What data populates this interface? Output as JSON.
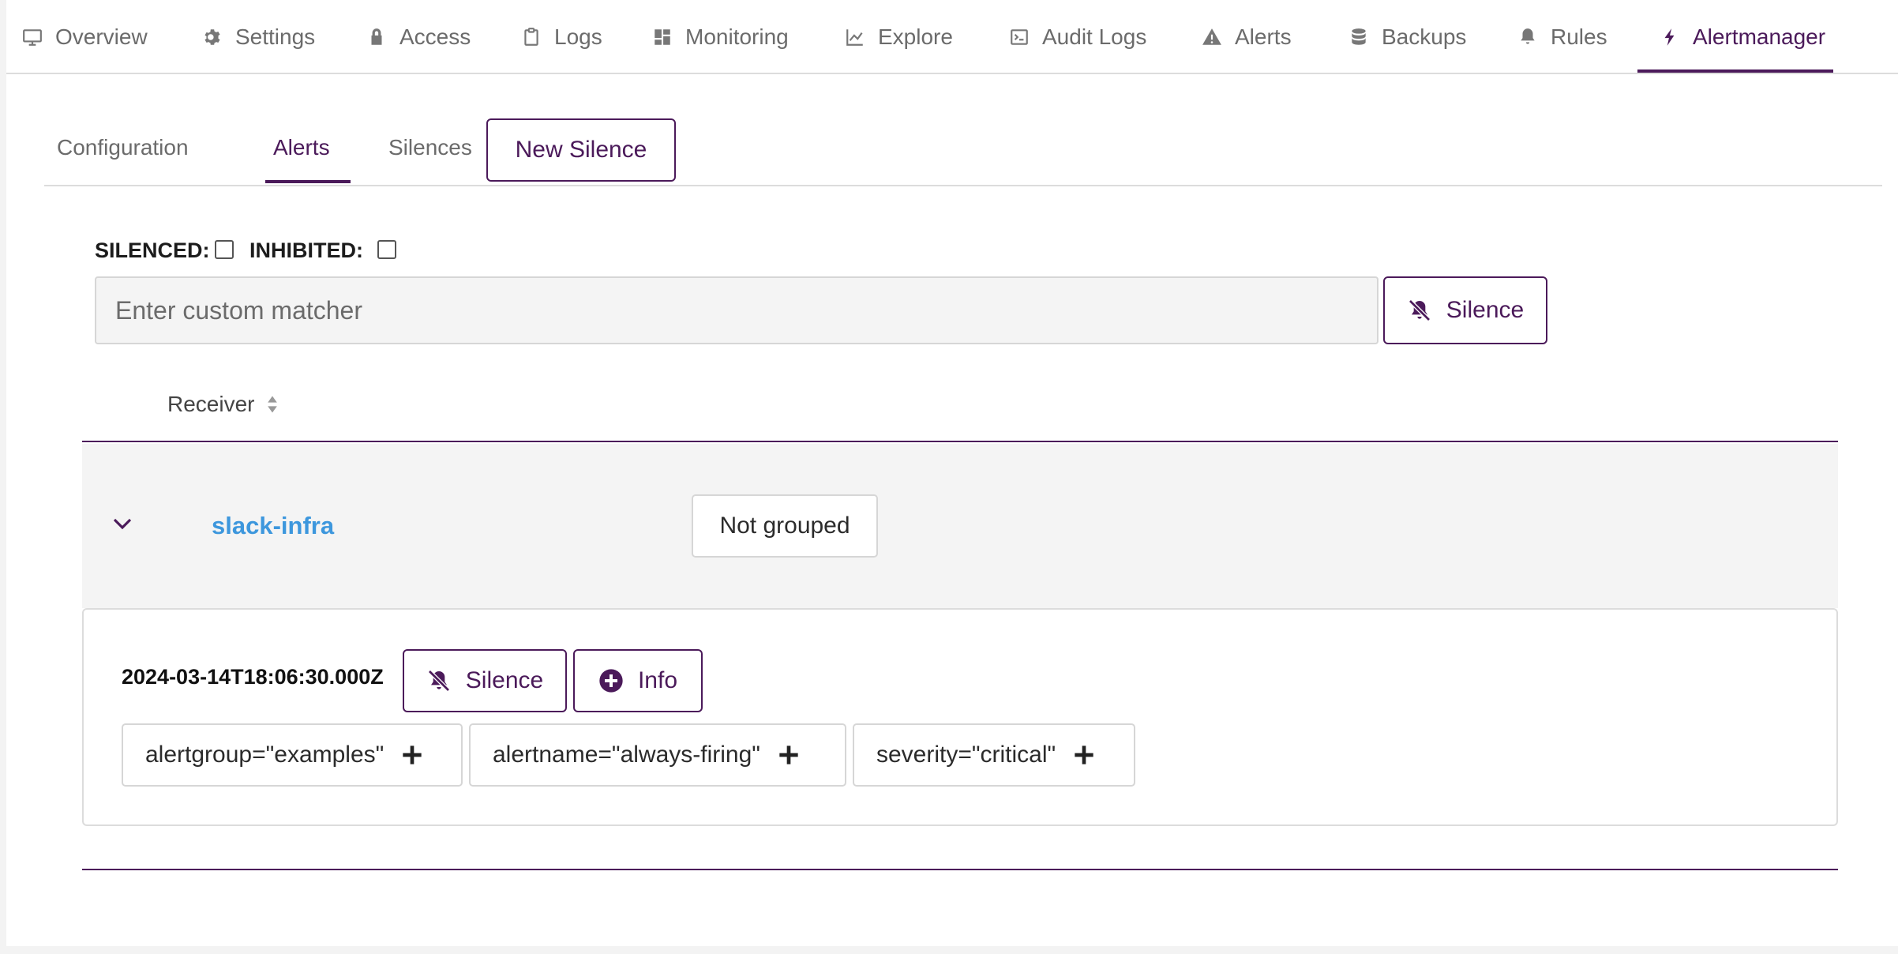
{
  "nav": {
    "items": [
      {
        "label": "Overview",
        "icon": "monitor-icon"
      },
      {
        "label": "Settings",
        "icon": "gear-icon"
      },
      {
        "label": "Access",
        "icon": "lock-icon"
      },
      {
        "label": "Logs",
        "icon": "clipboard-icon"
      },
      {
        "label": "Monitoring",
        "icon": "dashboard-icon"
      },
      {
        "label": "Explore",
        "icon": "line-chart-icon"
      },
      {
        "label": "Audit Logs",
        "icon": "terminal-icon"
      },
      {
        "label": "Alerts",
        "icon": "warning-icon"
      },
      {
        "label": "Backups",
        "icon": "database-icon"
      },
      {
        "label": "Rules",
        "icon": "bell-icon"
      },
      {
        "label": "Alertmanager",
        "icon": "bolt-icon"
      }
    ],
    "active": "Alertmanager"
  },
  "subtabs": {
    "items": [
      "Configuration",
      "Alerts",
      "Silences"
    ],
    "active": "Alerts",
    "new_silence_label": "New Silence"
  },
  "filters": {
    "silenced_label": "SILENCED:",
    "inhibited_label": "INHIBITED:",
    "matcher_placeholder": "Enter custom matcher",
    "silence_button_label": "Silence"
  },
  "table": {
    "receiver_header": "Receiver"
  },
  "group": {
    "receiver": "slack-infra",
    "grouping": "Not grouped",
    "alert": {
      "timestamp": "2024-03-14T18:06:30.000Z",
      "silence_label": "Silence",
      "info_label": "Info",
      "labels": [
        "alertgroup=\"examples\"",
        "alertname=\"always-firing\"",
        "severity=\"critical\""
      ]
    }
  },
  "colors": {
    "accent": "#4b1a5a",
    "link": "#3d97dd"
  }
}
